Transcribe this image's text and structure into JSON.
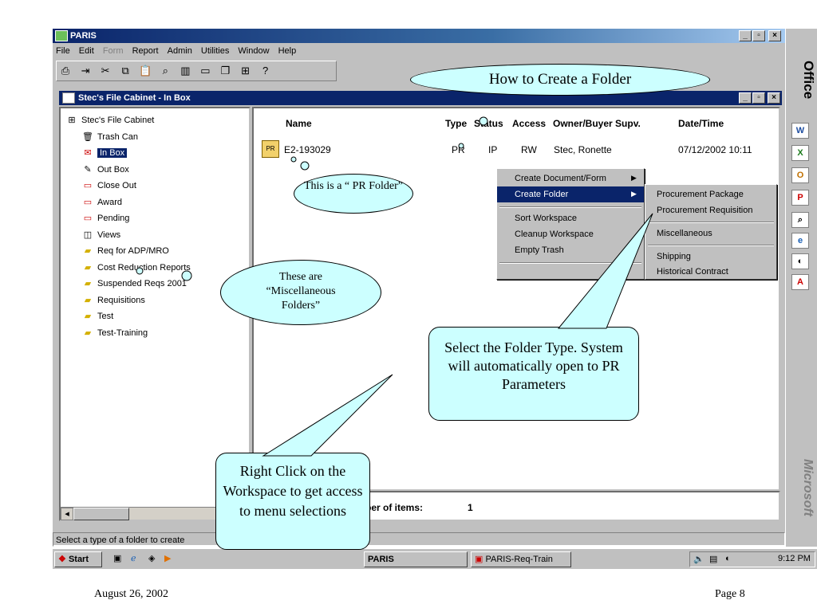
{
  "app": {
    "title": "PARIS"
  },
  "menubar": [
    "File",
    "Edit",
    "Form",
    "Report",
    "Admin",
    "Utilities",
    "Window",
    "Help"
  ],
  "cabinet": {
    "title": "Stec's File Cabinet - In Box"
  },
  "tree": [
    {
      "label": "Stec's File Cabinet",
      "icon": "cabinet-icon"
    },
    {
      "label": "Trash Can",
      "icon": "trash-icon"
    },
    {
      "label": "In Box",
      "icon": "inbox-icon",
      "selected": true
    },
    {
      "label": "Out Box",
      "icon": "outbox-icon"
    },
    {
      "label": "Close Out",
      "icon": "tray-icon"
    },
    {
      "label": "Award",
      "icon": "tray-icon"
    },
    {
      "label": "Pending",
      "icon": "tray-icon"
    },
    {
      "label": "Views",
      "icon": "views-icon"
    },
    {
      "label": "Req for ADP/MRO",
      "icon": "folder-icon"
    },
    {
      "label": "Cost Reduction Reports",
      "icon": "folder-icon"
    },
    {
      "label": "Suspended Reqs 2001",
      "icon": "folder-icon"
    },
    {
      "label": "Requisitions",
      "icon": "folder-icon"
    },
    {
      "label": "Test",
      "icon": "folder-icon"
    },
    {
      "label": "Test-Training",
      "icon": "folder-icon"
    }
  ],
  "list": {
    "columns": [
      "Name",
      "Type",
      "Status",
      "Access",
      "Owner/Buyer Supv.",
      "Date/Time"
    ],
    "rows": [
      {
        "name": "E2-193029",
        "type": "PR",
        "status": "IP",
        "access": "RW",
        "owner": "Stec, Ronette",
        "datetime": "07/12/2002 10:11"
      }
    ],
    "count_label": "ber of items:",
    "count": "1"
  },
  "context_menu": {
    "items": [
      "Create Document/Form",
      "Create Folder",
      "Sort Workspace",
      "Cleanup Workspace",
      "Empty Trash"
    ],
    "submenu": [
      "Procurement Package",
      "Procurement Requisition",
      "Miscellaneous",
      "Shipping",
      "Historical Contract"
    ]
  },
  "status": "Select a type of a folder to create",
  "taskbar": {
    "start": "Start",
    "tasks": [
      "PARIS",
      "PARIS-Req-Train"
    ],
    "clock": "9:12 PM"
  },
  "officebar": {
    "top_label": "Office",
    "bottom_label": "Microsoft"
  },
  "annotations": {
    "title": "How to Create a Folder",
    "pr_folder": "This is a “ PR Folder”",
    "misc_folders": "These are “Miscellaneous Folders”",
    "select_type": "Select the Folder Type. System will automatically open to PR Parameters",
    "right_click": "Right Click on the Workspace to get access to menu selections"
  },
  "footer": {
    "date": "August 26, 2002",
    "page": "Page 8"
  },
  "colors": {
    "titlebar": "#0a246a",
    "callout": "#ccffff",
    "chrome": "#c0c0c0"
  }
}
